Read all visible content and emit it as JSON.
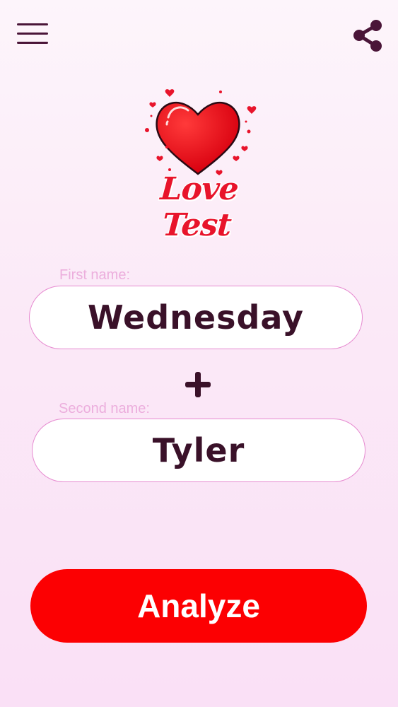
{
  "app": {
    "title": "Love Test"
  },
  "header": {
    "menu_icon": "hamburger-menu-icon",
    "share_icon": "share-icon",
    "icon_color": "#4a1538"
  },
  "logo": {
    "title": "Love Test",
    "icon": "heart-icon",
    "color": "#e8142b"
  },
  "form": {
    "first_name": {
      "label": "First name:",
      "value": "Wednesday"
    },
    "plus_icon": "plus-icon",
    "second_name": {
      "label": "Second name:",
      "value": "Tyler"
    },
    "analyze_label": "Analyze",
    "analyze_color": "#fc0002"
  }
}
